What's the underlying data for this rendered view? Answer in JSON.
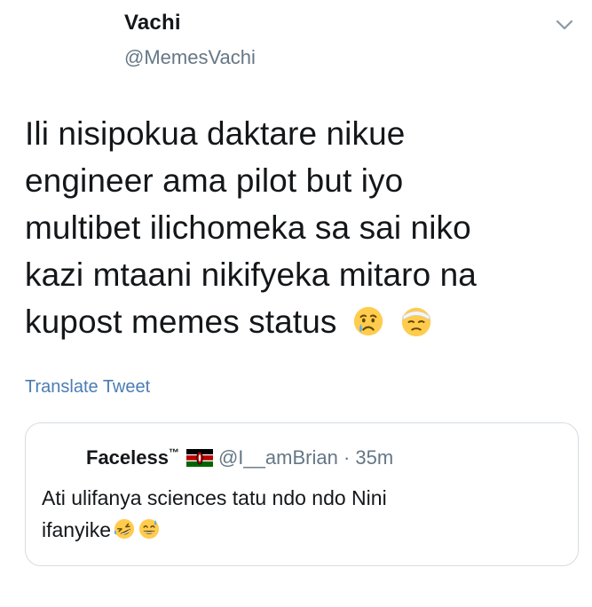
{
  "tweet": {
    "display_name": "Vachi",
    "handle": "@MemesVachi",
    "text_lines": [
      "Ili nisipokua daktare nikue",
      "engineer ama pilot but iyo",
      "multibet ilichomeka sa sai niko",
      "kazi mtaani nikifyeka mitaro na",
      "kupost memes status"
    ],
    "emojis": [
      "crying-face-emoji",
      "bandaged-face-emoji"
    ],
    "translate_label": "Translate Tweet"
  },
  "quoted_tweet": {
    "display_name": "Faceless",
    "trademark": "™",
    "flag": "kenya-flag-icon",
    "handle": "@I__amBrian",
    "separator": "·",
    "time": "35m",
    "text_lines": [
      "Ati ulifanya sciences tatu ndo ndo Nini",
      "ifanyike"
    ],
    "emojis": [
      "rolling-laughing-emoji",
      "sweat-smile-emoji"
    ]
  },
  "colors": {
    "text_primary": "#14171a",
    "text_secondary": "#657786",
    "link": "#4a7db5",
    "card_border": "#d5dce2"
  }
}
